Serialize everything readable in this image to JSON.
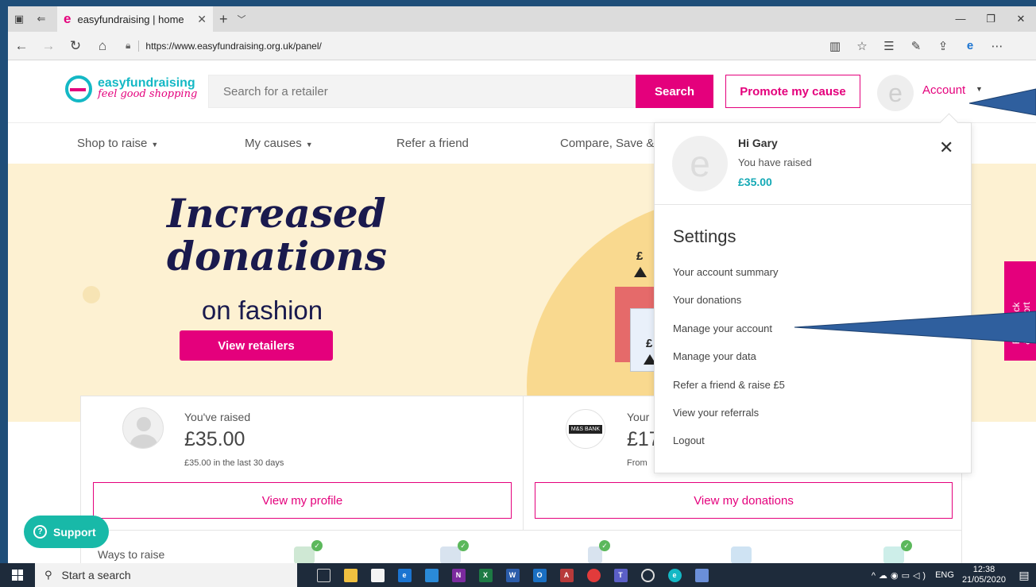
{
  "browser": {
    "tab_title": "easyfundraising | home",
    "url": "https://www.easyfundraising.org.uk/panel/"
  },
  "header": {
    "brand_name": "easyfundraising",
    "brand_tagline": "feel good shopping",
    "search_placeholder": "Search for a retailer",
    "search_button": "Search",
    "promote_button": "Promote my cause",
    "account_label": "Account"
  },
  "nav": {
    "items": [
      {
        "label": "Shop to raise"
      },
      {
        "label": "My causes"
      },
      {
        "label": "Refer a friend"
      },
      {
        "label": "Compare, Save &"
      }
    ]
  },
  "hero": {
    "headline_line1": "Increased",
    "headline_line2": "donations",
    "subline": "on fashion",
    "button": "View retailers",
    "symbol": "£"
  },
  "summary": {
    "raised_label": "You've raised",
    "raised_amount": "£35.00",
    "raised_30days": "£35.00 in the last 30 days",
    "profile_button": "View my profile",
    "partner_logo": "M&S BANK",
    "partner_label": "Your",
    "partner_amount": "£17",
    "partner_from": "From",
    "donations_button": "View my donations",
    "ways_label": "Ways to raise"
  },
  "dropdown": {
    "greeting": "Hi Gary",
    "raised_text": "You have raised",
    "raised_amount": "£35.00",
    "settings_heading": "Settings",
    "items": [
      {
        "label": "Your account summary"
      },
      {
        "label": "Your donations"
      },
      {
        "label": "Manage your account"
      },
      {
        "label": "Manage your data"
      },
      {
        "label": "Refer a friend & raise £5"
      },
      {
        "label": "View your referrals"
      },
      {
        "label": "Logout"
      }
    ]
  },
  "widgets": {
    "support_label": "Support",
    "feedback_label": "Feedback\n& Support"
  },
  "taskbar": {
    "search_placeholder": "Start a search",
    "language": "ENG",
    "time": "12:38",
    "date": "21/05/2020"
  },
  "colors": {
    "brand_pink": "#e4007c",
    "brand_teal": "#14b8c5",
    "hero_bg": "#fdf1d2",
    "callout_fill": "#2f5f9e"
  }
}
